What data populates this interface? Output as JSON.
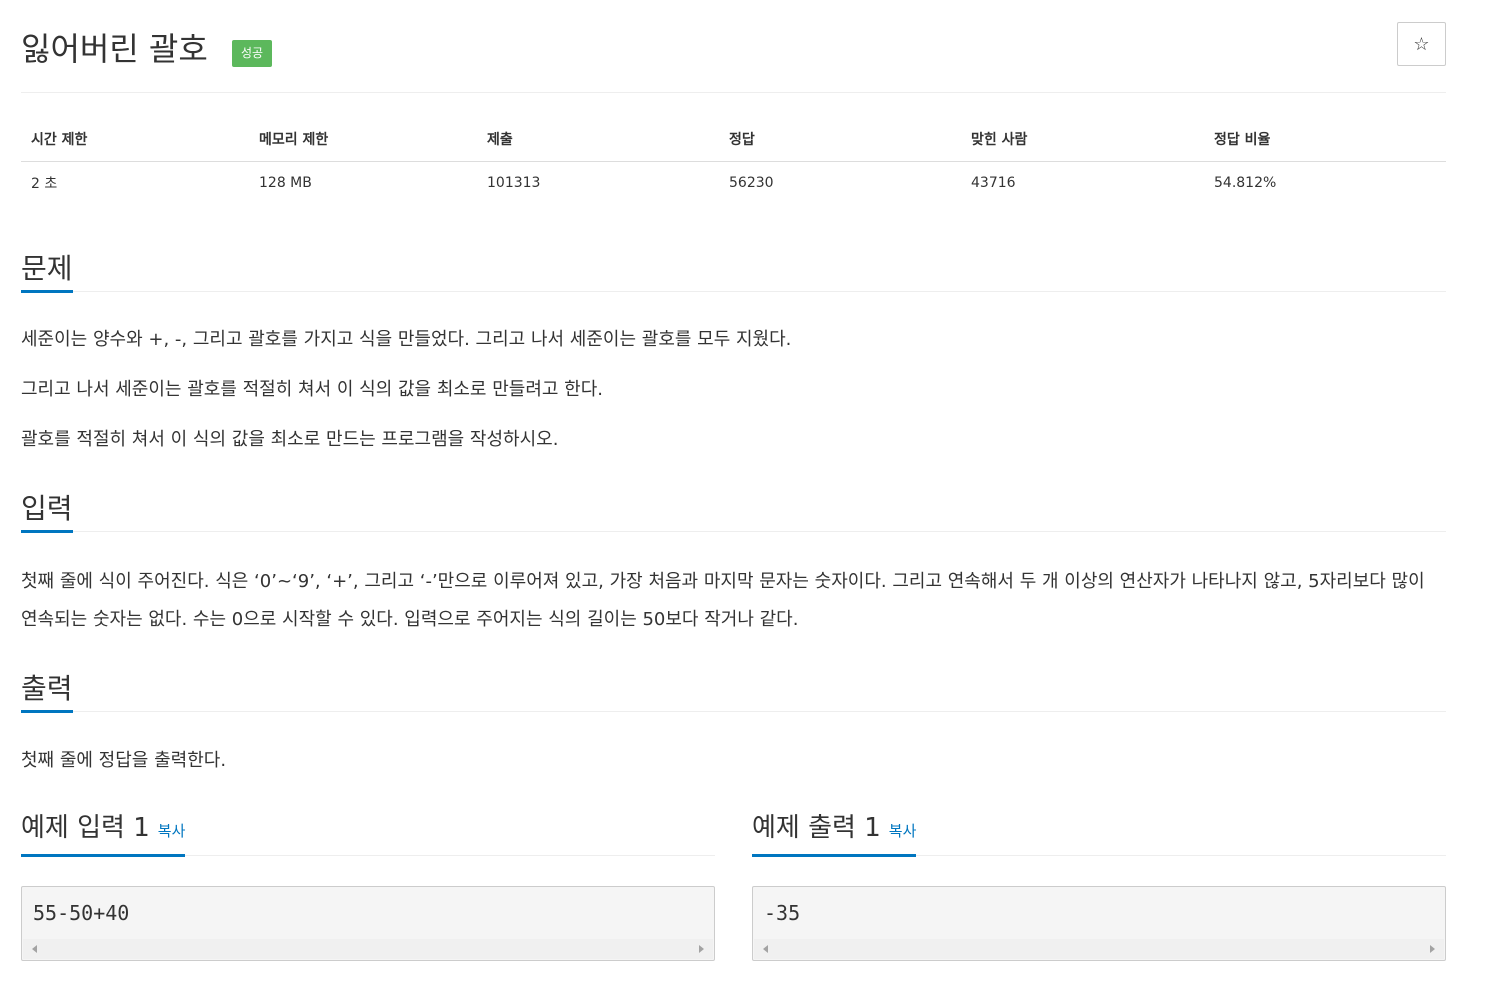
{
  "problem": {
    "title": "잃어버린 괄호",
    "status_badge": "성공",
    "star_icon": "☆"
  },
  "stats": {
    "headers": [
      "시간 제한",
      "메모리 제한",
      "제출",
      "정답",
      "맞힌 사람",
      "정답 비율"
    ],
    "values": [
      "2 초",
      "128 MB",
      "101313",
      "56230",
      "43716",
      "54.812%"
    ]
  },
  "sections": {
    "description": {
      "heading": "문제",
      "paragraphs": [
        "세준이는 양수와 +, -, 그리고 괄호를 가지고 식을 만들었다. 그리고 나서 세준이는 괄호를 모두 지웠다.",
        "그리고 나서 세준이는 괄호를 적절히 쳐서 이 식의 값을 최소로 만들려고 한다.",
        "괄호를 적절히 쳐서 이 식의 값을 최소로 만드는 프로그램을 작성하시오."
      ]
    },
    "input": {
      "heading": "입력",
      "text": "첫째 줄에 식이 주어진다. 식은 ‘0’~‘9’, ‘+’, 그리고 ‘-’만으로 이루어져 있고, 가장 처음과 마지막 문자는 숫자이다. 그리고 연속해서 두 개 이상의 연산자가 나타나지 않고, 5자리보다 많이 연속되는 숫자는 없다. 수는 0으로 시작할 수 있다. 입력으로 주어지는 식의 길이는 50보다 작거나 같다."
    },
    "output": {
      "heading": "출력",
      "text": "첫째 줄에 정답을 출력한다."
    }
  },
  "samples": {
    "input": {
      "heading": "예제 입력 1",
      "copy_label": "복사",
      "content": "55-50+40"
    },
    "output": {
      "heading": "예제 출력 1",
      "copy_label": "복사",
      "content": "-35"
    }
  },
  "colors": {
    "accent": "#0076c0",
    "badge_success": "#5cb85c"
  }
}
